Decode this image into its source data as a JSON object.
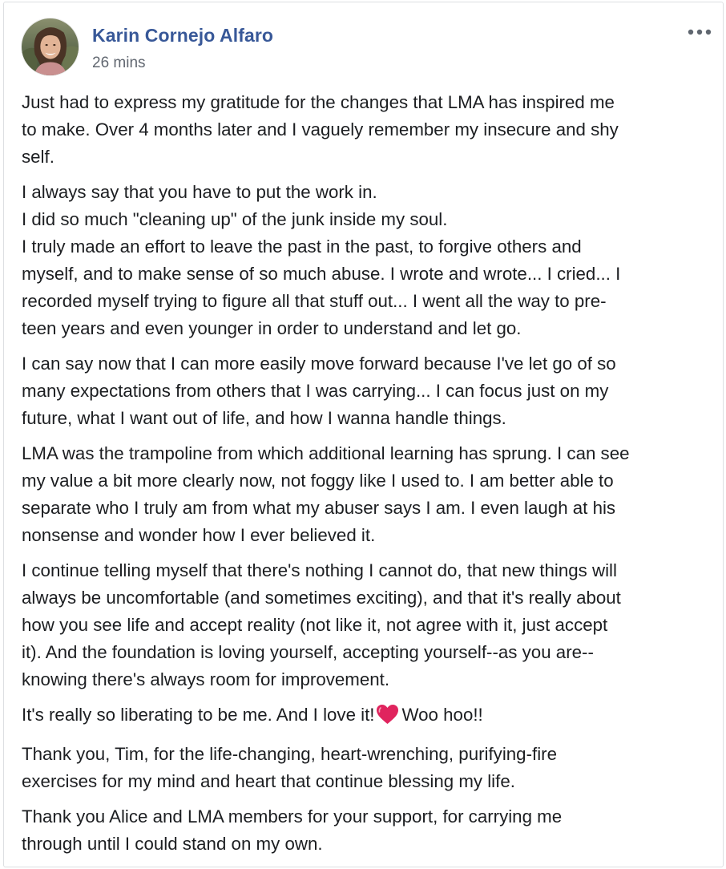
{
  "post": {
    "author_name": "Karin Cornejo Alfaro",
    "timestamp": "26 mins",
    "avatar_icon": "profile-photo",
    "more_icon": "ellipsis-icon",
    "colors": {
      "author": "#385898",
      "text": "#1c1e21",
      "meta": "#616770",
      "heart": "#e0245e"
    },
    "paragraphs": [
      {
        "lines": [
          "Just had to express my gratitude for the changes that LMA has inspired me",
          "to make. Over 4 months later and I vaguely remember my insecure and shy",
          "self."
        ]
      },
      {
        "lines": [
          "I always say that you have to put the work in.",
          "I did so much \"cleaning up\" of the junk inside my soul.",
          "I truly made an effort to leave the past in the past, to forgive others and",
          "myself, and to make sense of so much abuse. I wrote and wrote... I cried... I",
          "recorded myself trying to figure all that stuff out... I went all the way to pre-",
          "teen years and even younger in order to understand and let go."
        ]
      },
      {
        "lines": [
          "I can say now that I can more easily move forward because I've let go of so",
          "many expectations from others that I was carrying... I can focus just on my",
          "future, what I want out of life, and how I wanna handle things."
        ]
      },
      {
        "lines": [
          "LMA was the trampoline from which additional learning has sprung. I can see",
          "my value a bit more clearly now, not foggy like I used to. I am better able to",
          "separate who I truly am from what my abuser says I am. I even laugh at his",
          "nonsense and wonder how I ever believed it."
        ]
      },
      {
        "lines": [
          "I continue telling myself that there's nothing I cannot do, that new things will",
          "always be uncomfortable (and sometimes exciting), and that it's really about",
          "how you see life and accept reality (not like it, not agree with it, just accept",
          "it). And the foundation is loving yourself, accepting yourself--as you are--",
          "knowing there's always room for improvement."
        ]
      },
      {
        "before_heart": "It's really so liberating to be me. And I love it!",
        "heart_icon": "red-heart-emoji",
        "after_heart": "Woo hoo!!"
      },
      {
        "lines": [
          "Thank you, Tim, for the life-changing, heart-wrenching, purifying-fire",
          "exercises for my mind and heart that continue blessing my life."
        ]
      },
      {
        "lines": [
          "Thank you Alice and LMA members for your support, for carrying me",
          "through until I could stand on my own."
        ]
      }
    ]
  }
}
